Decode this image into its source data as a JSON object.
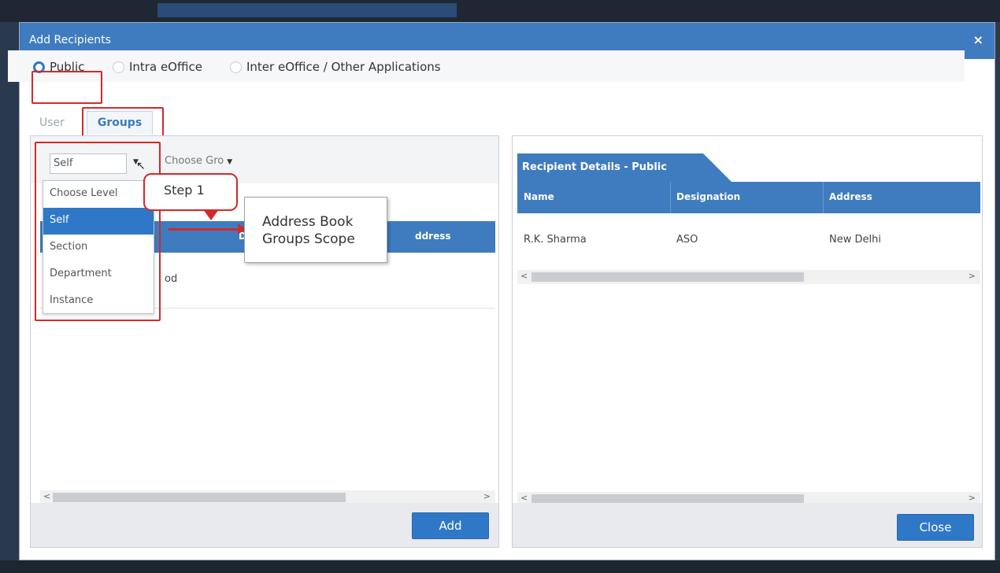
{
  "dialog": {
    "title": "Add Recipients",
    "close_icon": "×"
  },
  "radios": [
    {
      "label": "Public",
      "selected": true
    },
    {
      "label": "Intra eOffice",
      "selected": false
    },
    {
      "label": "Inter eOffice / Other Applications",
      "selected": false
    }
  ],
  "tabs": {
    "user": "User",
    "groups": "Groups",
    "active": "Groups"
  },
  "left_panel": {
    "scope_select": {
      "value": "Self",
      "options": [
        "Choose Level",
        "Self",
        "Section",
        "Department",
        "Instance"
      ]
    },
    "group_select": {
      "placeholder": "Choose Gro"
    },
    "table_header": {
      "col_partial_1": "D",
      "col_partial_2": "ddress"
    },
    "row_partial": "od",
    "add_button": "Add"
  },
  "annotations": {
    "step": "Step 1",
    "info_line1": "Address Book",
    "info_line2": "Groups Scope"
  },
  "right_panel": {
    "tab_title": "Recipient Details - Public",
    "columns": [
      "Name",
      "Designation",
      "Address"
    ],
    "rows": [
      {
        "name": "R.K. Sharma",
        "designation": "ASO",
        "address": "New Delhi"
      }
    ],
    "close_button": "Close"
  },
  "colors": {
    "accent": "#3f7bbf",
    "button": "#2f78c8",
    "annotation_red": "#d32a2a"
  }
}
